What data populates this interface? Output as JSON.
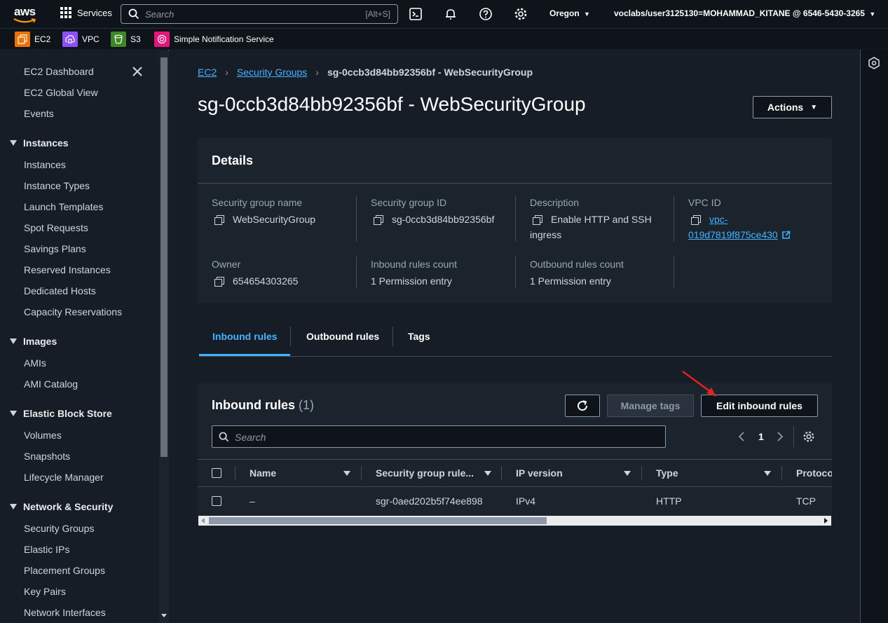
{
  "topnav": {
    "services_label": "Services",
    "search_placeholder": "Search",
    "search_shortcut": "[Alt+S]",
    "region": "Oregon",
    "account": "voclabs/user3125130=MOHAMMAD_KITANE @ 6546-5430-3265"
  },
  "favorites": [
    {
      "label": "EC2",
      "color": "#ed7100"
    },
    {
      "label": "VPC",
      "color": "#8c4fff"
    },
    {
      "label": "S3",
      "color": "#3f8624"
    },
    {
      "label": "Simple Notification Service",
      "color": "#e7157b"
    }
  ],
  "sidebar": {
    "top_items": [
      "EC2 Dashboard",
      "EC2 Global View",
      "Events"
    ],
    "sections": [
      {
        "title": "Instances",
        "items": [
          "Instances",
          "Instance Types",
          "Launch Templates",
          "Spot Requests",
          "Savings Plans",
          "Reserved Instances",
          "Dedicated Hosts",
          "Capacity Reservations"
        ]
      },
      {
        "title": "Images",
        "items": [
          "AMIs",
          "AMI Catalog"
        ]
      },
      {
        "title": "Elastic Block Store",
        "items": [
          "Volumes",
          "Snapshots",
          "Lifecycle Manager"
        ]
      },
      {
        "title": "Network & Security",
        "items": [
          "Security Groups",
          "Elastic IPs",
          "Placement Groups",
          "Key Pairs",
          "Network Interfaces"
        ]
      }
    ]
  },
  "breadcrumb": {
    "root": "EC2",
    "parent": "Security Groups",
    "current": "sg-0ccb3d84bb92356bf - WebSecurityGroup"
  },
  "page_title": "sg-0ccb3d84bb92356bf - WebSecurityGroup",
  "actions_label": "Actions",
  "details": {
    "header": "Details",
    "sg_name_label": "Security group name",
    "sg_name": "WebSecurityGroup",
    "sg_id_label": "Security group ID",
    "sg_id": "sg-0ccb3d84bb92356bf",
    "description_label": "Description",
    "description_line1": "Enable HTTP and SSH",
    "description_line2": "ingress",
    "vpc_label": "VPC ID",
    "vpc_line1": "vpc-",
    "vpc_line2": "019d7819f875ce430",
    "owner_label": "Owner",
    "owner": "654654303265",
    "inbound_count_label": "Inbound rules count",
    "inbound_count": "1 Permission entry",
    "outbound_count_label": "Outbound rules count",
    "outbound_count": "1 Permission entry"
  },
  "tabs": [
    "Inbound rules",
    "Outbound rules",
    "Tags"
  ],
  "active_tab": "Inbound rules",
  "inbound": {
    "title": "Inbound rules",
    "count": "(1)",
    "manage_tags_label": "Manage tags",
    "edit_label": "Edit inbound rules",
    "search_placeholder": "Search",
    "page": "1",
    "columns": [
      "Name",
      "Security group rule...",
      "IP version",
      "Type",
      "Protoco"
    ],
    "rows": [
      {
        "name": "–",
        "rule_id": "sgr-0aed202b5f74ee898",
        "ip_version": "IPv4",
        "type": "HTTP",
        "protocol": "TCP"
      }
    ]
  },
  "colors": {
    "accent_link": "#42b4ff",
    "annotation_arrow": "#e0231e"
  }
}
